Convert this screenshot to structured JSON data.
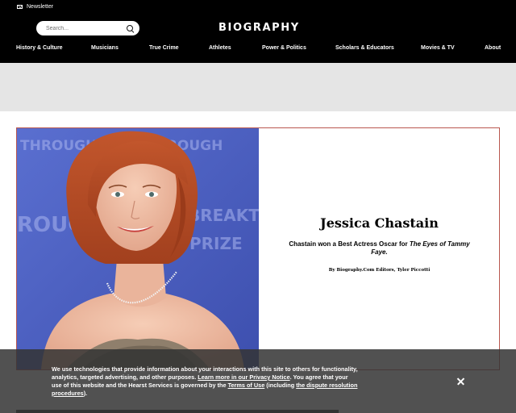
{
  "header": {
    "newsletter_label": "Newsletter",
    "search_placeholder": "Search...",
    "logo": "BIOGRAPHY",
    "nav": [
      "History & Culture",
      "Musicians",
      "True Crime",
      "Athletes",
      "Power & Politics",
      "Scholars & Educators",
      "Movies & TV",
      "About"
    ]
  },
  "hero": {
    "name": "Jessica Chastain",
    "dek_prefix": "Chastain won a Best Actress Oscar for ",
    "dek_title": "The Eyes of Tammy Faye.",
    "byline": "By Biography.Com Editors, Tyler Piccotti",
    "backdrop_text": [
      "THROUGH",
      "THROUGH",
      "BREAKTHR",
      "PRIZE",
      "ROUGH"
    ]
  },
  "cookie": {
    "text_1": "We use technologies that provide information about your interactions with this site to others for functionality, analytics, targeted advertising, and other purposes. ",
    "link_1": "Learn more in our Privacy Notice",
    "text_2": ". You agree that your use of this website and the Hearst Services is governed by the ",
    "link_2": "Terms of Use",
    "text_3": " (including ",
    "link_3": "the dispute resolution procedures",
    "text_4": ")."
  },
  "colors": {
    "header_bg": "#000000",
    "hero_border": "#b9574f",
    "photo_backdrop": "#4a5fc0"
  }
}
